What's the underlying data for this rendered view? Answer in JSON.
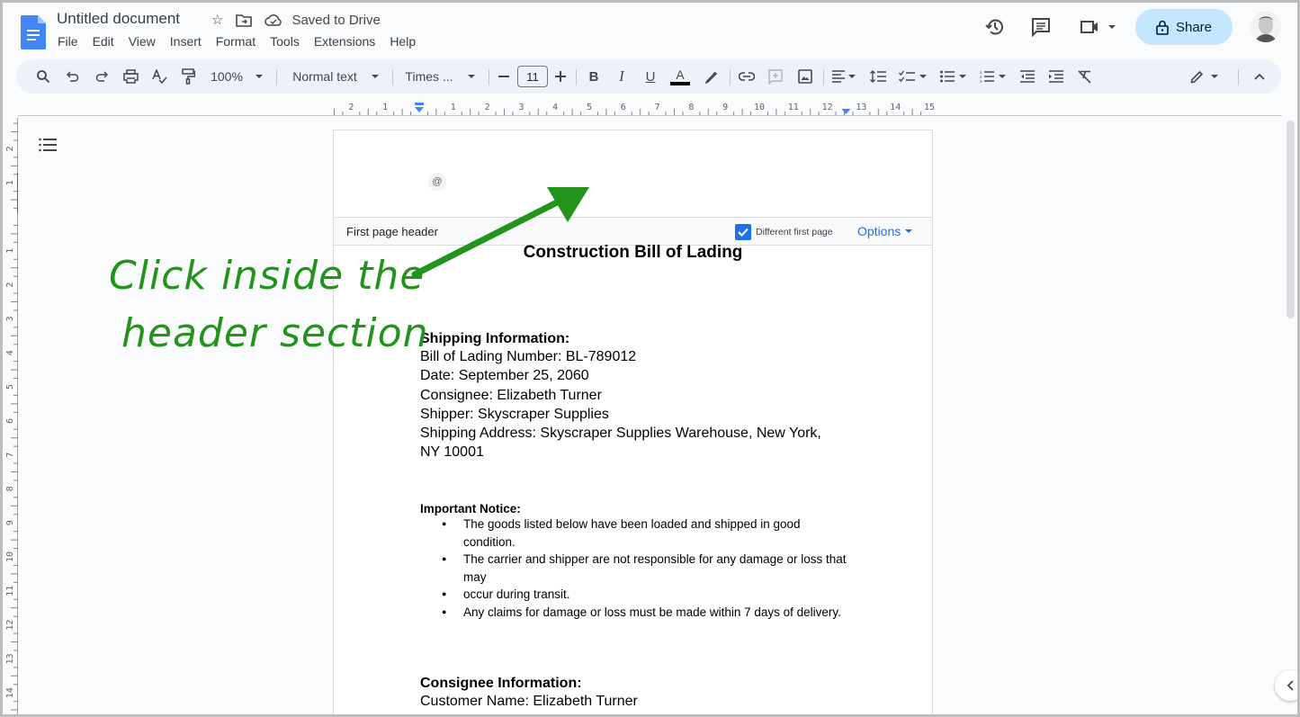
{
  "app": {
    "doc_title": "Untitled document",
    "save_status": "Saved to Drive",
    "menu": [
      "File",
      "Edit",
      "View",
      "Insert",
      "Format",
      "Tools",
      "Extensions",
      "Help"
    ],
    "share_label": "Share"
  },
  "toolbar": {
    "zoom": "100%",
    "style": "Normal text",
    "font": "Times ...",
    "font_size": "11",
    "text_color": "#000000"
  },
  "ruler": {
    "horizontal_labels": [
      "2",
      "1",
      "1",
      "2",
      "3",
      "4",
      "5",
      "6",
      "7",
      "8",
      "9",
      "10",
      "11",
      "12",
      "13",
      "14",
      "15"
    ],
    "vertical_labels": [
      "2",
      "1",
      "1",
      "2",
      "3",
      "4",
      "5",
      "6",
      "7",
      "8",
      "9",
      "10",
      "11",
      "12",
      "13",
      "14"
    ]
  },
  "header_bar": {
    "label": "First page header",
    "different_first_page_label": "Different first page",
    "different_first_page_checked": true,
    "options_label": "Options",
    "at_chip": "@"
  },
  "document": {
    "title": "Construction Bill of Lading",
    "shipping": {
      "heading": "Shipping Information:",
      "lines": [
        "Bill of Lading Number: BL-789012",
        "Date: September 25, 2060",
        "Consignee: Elizabeth Turner",
        "Shipper: Skyscraper Supplies",
        "Shipping Address: Skyscraper Supplies Warehouse, New York,",
        "NY 10001"
      ]
    },
    "notice": {
      "heading": "Important Notice:",
      "bullets": [
        "The goods listed below have been loaded and shipped in good condition.",
        "The carrier and shipper are not responsible for any damage or loss that may",
        "occur during transit.",
        "Any claims for damage or loss must be made within 7 days of delivery."
      ]
    },
    "consignee": {
      "heading": "Consignee Information:",
      "lines": [
        "Customer Name: Elizabeth Turner"
      ]
    }
  },
  "annotation": {
    "line1": "Click inside the",
    "line2": "header section",
    "color": "#22941b"
  },
  "colors": {
    "accent": "#1a73e8",
    "share_bg": "#c2e7ff",
    "toolbar_bg": "#edf2fa"
  }
}
